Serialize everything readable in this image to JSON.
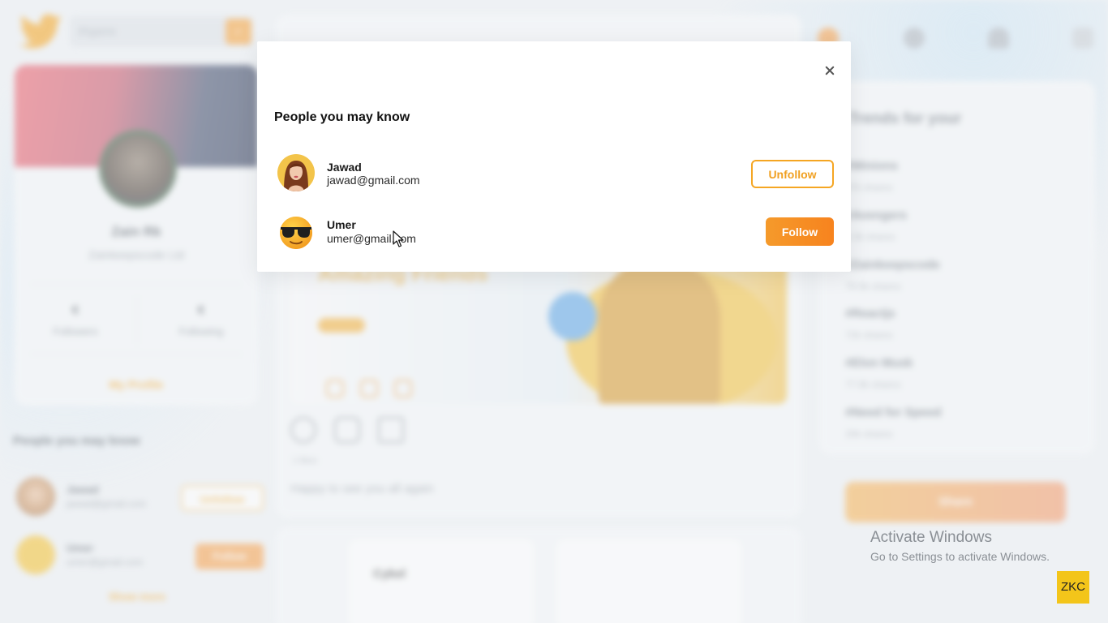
{
  "background": {
    "search_placeholder": "#hgame",
    "profile": {
      "name": "Zain Rk",
      "handle": "Zainkeepscode Ltd",
      "followers_count": "€",
      "followers_label": "Followers",
      "following_count": "€",
      "following_label": "Following",
      "my_profile": "My Profile"
    },
    "pymk": {
      "title": "People you may know",
      "people": [
        {
          "name": "Jawad",
          "email": "jawad@gmail.com",
          "action": "Unfollow"
        },
        {
          "name": "Umer",
          "email": "umer@gmail.com",
          "action": "Follow"
        }
      ],
      "more": "Show more"
    },
    "feed": {
      "banner_title": "Amazing Friends",
      "likes": "1 likes",
      "caption": "Happy to see you all again",
      "app_name": "Cykel"
    },
    "trends": {
      "title": "Trends for your",
      "items": [
        {
          "tag": "#Minions",
          "count": "97k shares"
        },
        {
          "tag": "#Avengers",
          "count": "8.3k shares"
        },
        {
          "tag": "#Zainkeepscode",
          "count": "79.9k shares"
        },
        {
          "tag": "#Reactjs",
          "count": "72k shares"
        },
        {
          "tag": "#Elon Musk",
          "count": "77.8k shares"
        },
        {
          "tag": "#Need for Speed",
          "count": "20k shares"
        }
      ],
      "share_button": "Share"
    }
  },
  "modal": {
    "title": "People you may know",
    "people": [
      {
        "name": "Jawad",
        "email": "jawad@gmail.com",
        "action": "Unfollow"
      },
      {
        "name": "Umer",
        "email": "umer@gmail.com",
        "action": "Follow"
      }
    ]
  },
  "watermark": {
    "title": "Activate Windows",
    "subtitle": "Go to Settings to activate Windows.",
    "badge": "ZKC"
  },
  "colors": {
    "accent": "#f5a623",
    "follow_button": "#f7831e",
    "modal_background": "#ffffff"
  }
}
